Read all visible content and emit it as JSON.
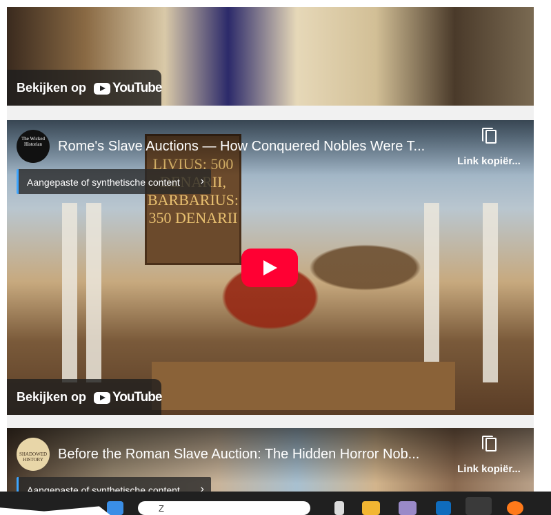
{
  "videos": [
    {
      "watch_label": "Bekijken op",
      "youtube_label": "YouTube"
    },
    {
      "channel_avatar": "The Wicked Historian",
      "title": "Rome's Slave Auctions — How Conquered Nobles Were T...",
      "copy_label": "Link kopiër...",
      "synthetic_label": "Aangepaste of synthetische content",
      "sign_text": "LIVIUS: 500 DENARII, BARBARIUS: 350 DENARII",
      "watch_label": "Bekijken op",
      "youtube_label": "YouTube"
    },
    {
      "channel_avatar": "SHADOWED HISTORY",
      "title": "Before the Roman Slave Auction: The Hidden Horror Nob...",
      "copy_label": "Link kopiër...",
      "synthetic_label": "Aangepaste of synthetische content"
    }
  ],
  "taskbar": {
    "search_placeholder": "Z"
  },
  "colors": {
    "youtube_red": "#ff0033",
    "synthetic_accent": "#3ea6ff"
  }
}
